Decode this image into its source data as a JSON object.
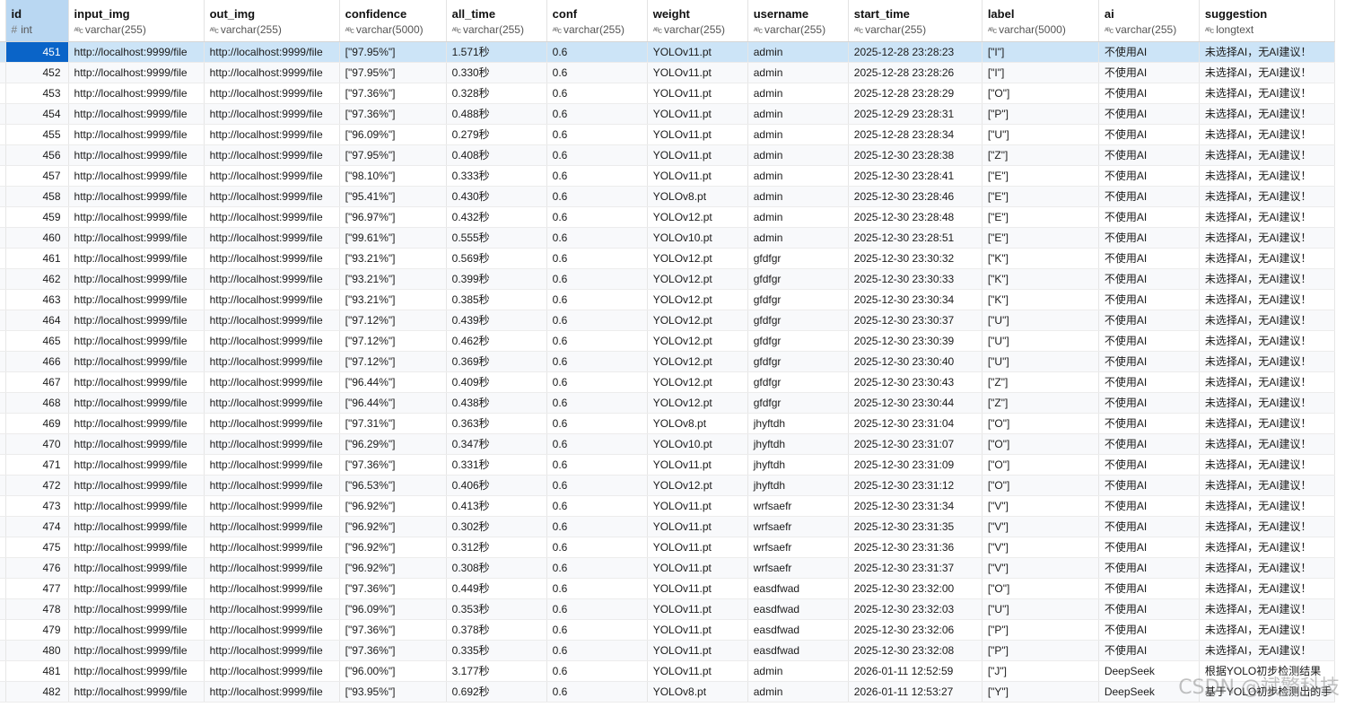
{
  "columns": [
    {
      "name": "id",
      "type": "int",
      "icon": "hash-icon"
    },
    {
      "name": "input_img",
      "type": "varchar(255)",
      "icon": "text-type-icon"
    },
    {
      "name": "out_img",
      "type": "varchar(255)",
      "icon": "text-type-icon"
    },
    {
      "name": "confidence",
      "type": "varchar(5000)",
      "icon": "text-type-icon"
    },
    {
      "name": "all_time",
      "type": "varchar(255)",
      "icon": "text-type-icon"
    },
    {
      "name": "conf",
      "type": "varchar(255)",
      "icon": "text-type-icon"
    },
    {
      "name": "weight",
      "type": "varchar(255)",
      "icon": "text-type-icon"
    },
    {
      "name": "username",
      "type": "varchar(255)",
      "icon": "text-type-icon"
    },
    {
      "name": "start_time",
      "type": "varchar(255)",
      "icon": "text-type-icon"
    },
    {
      "name": "label",
      "type": "varchar(5000)",
      "icon": "text-type-icon"
    },
    {
      "name": "ai",
      "type": "varchar(255)",
      "icon": "text-type-icon"
    },
    {
      "name": "suggestion",
      "type": "longtext",
      "icon": "text-type-icon"
    }
  ],
  "type_glyphs": {
    "hash": "#",
    "text": "ᴬᴮc"
  },
  "selected_row_index": 0,
  "rows": [
    [
      "451",
      "http://localhost:9999/file",
      "http://localhost:9999/file",
      "[\"97.95%\"]",
      "1.571秒",
      "0.6",
      "YOLOv11.pt",
      "admin",
      "2025-12-28 23:28:23",
      "[\"I\"]",
      "不使用AI",
      "未选择AI，无AI建议！"
    ],
    [
      "452",
      "http://localhost:9999/file",
      "http://localhost:9999/file",
      "[\"97.95%\"]",
      "0.330秒",
      "0.6",
      "YOLOv11.pt",
      "admin",
      "2025-12-28 23:28:26",
      "[\"I\"]",
      "不使用AI",
      "未选择AI，无AI建议！"
    ],
    [
      "453",
      "http://localhost:9999/file",
      "http://localhost:9999/file",
      "[\"97.36%\"]",
      "0.328秒",
      "0.6",
      "YOLOv11.pt",
      "admin",
      "2025-12-28 23:28:29",
      "[\"O\"]",
      "不使用AI",
      "未选择AI，无AI建议！"
    ],
    [
      "454",
      "http://localhost:9999/file",
      "http://localhost:9999/file",
      "[\"97.36%\"]",
      "0.488秒",
      "0.6",
      "YOLOv11.pt",
      "admin",
      "2025-12-29 23:28:31",
      "[\"P\"]",
      "不使用AI",
      "未选择AI，无AI建议！"
    ],
    [
      "455",
      "http://localhost:9999/file",
      "http://localhost:9999/file",
      "[\"96.09%\"]",
      "0.279秒",
      "0.6",
      "YOLOv11.pt",
      "admin",
      "2025-12-28 23:28:34",
      "[\"U\"]",
      "不使用AI",
      "未选择AI，无AI建议！"
    ],
    [
      "456",
      "http://localhost:9999/file",
      "http://localhost:9999/file",
      "[\"97.95%\"]",
      "0.408秒",
      "0.6",
      "YOLOv11.pt",
      "admin",
      "2025-12-30 23:28:38",
      "[\"Z\"]",
      "不使用AI",
      "未选择AI，无AI建议！"
    ],
    [
      "457",
      "http://localhost:9999/file",
      "http://localhost:9999/file",
      "[\"98.10%\"]",
      "0.333秒",
      "0.6",
      "YOLOv11.pt",
      "admin",
      "2025-12-30 23:28:41",
      "[\"E\"]",
      "不使用AI",
      "未选择AI，无AI建议！"
    ],
    [
      "458",
      "http://localhost:9999/file",
      "http://localhost:9999/file",
      "[\"95.41%\"]",
      "0.430秒",
      "0.6",
      "YOLOv8.pt",
      "admin",
      "2025-12-30 23:28:46",
      "[\"E\"]",
      "不使用AI",
      "未选择AI，无AI建议！"
    ],
    [
      "459",
      "http://localhost:9999/file",
      "http://localhost:9999/file",
      "[\"96.97%\"]",
      "0.432秒",
      "0.6",
      "YOLOv12.pt",
      "admin",
      "2025-12-30 23:28:48",
      "[\"E\"]",
      "不使用AI",
      "未选择AI，无AI建议！"
    ],
    [
      "460",
      "http://localhost:9999/file",
      "http://localhost:9999/file",
      "[\"99.61%\"]",
      "0.555秒",
      "0.6",
      "YOLOv10.pt",
      "admin",
      "2025-12-30 23:28:51",
      "[\"E\"]",
      "不使用AI",
      "未选择AI，无AI建议！"
    ],
    [
      "461",
      "http://localhost:9999/file",
      "http://localhost:9999/file",
      "[\"93.21%\"]",
      "0.569秒",
      "0.6",
      "YOLOv12.pt",
      "gfdfgr",
      "2025-12-30 23:30:32",
      "[\"K\"]",
      "不使用AI",
      "未选择AI，无AI建议！"
    ],
    [
      "462",
      "http://localhost:9999/file",
      "http://localhost:9999/file",
      "[\"93.21%\"]",
      "0.399秒",
      "0.6",
      "YOLOv12.pt",
      "gfdfgr",
      "2025-12-30 23:30:33",
      "[\"K\"]",
      "不使用AI",
      "未选择AI，无AI建议！"
    ],
    [
      "463",
      "http://localhost:9999/file",
      "http://localhost:9999/file",
      "[\"93.21%\"]",
      "0.385秒",
      "0.6",
      "YOLOv12.pt",
      "gfdfgr",
      "2025-12-30 23:30:34",
      "[\"K\"]",
      "不使用AI",
      "未选择AI，无AI建议！"
    ],
    [
      "464",
      "http://localhost:9999/file",
      "http://localhost:9999/file",
      "[\"97.12%\"]",
      "0.439秒",
      "0.6",
      "YOLOv12.pt",
      "gfdfgr",
      "2025-12-30 23:30:37",
      "[\"U\"]",
      "不使用AI",
      "未选择AI，无AI建议！"
    ],
    [
      "465",
      "http://localhost:9999/file",
      "http://localhost:9999/file",
      "[\"97.12%\"]",
      "0.462秒",
      "0.6",
      "YOLOv12.pt",
      "gfdfgr",
      "2025-12-30 23:30:39",
      "[\"U\"]",
      "不使用AI",
      "未选择AI，无AI建议！"
    ],
    [
      "466",
      "http://localhost:9999/file",
      "http://localhost:9999/file",
      "[\"97.12%\"]",
      "0.369秒",
      "0.6",
      "YOLOv12.pt",
      "gfdfgr",
      "2025-12-30 23:30:40",
      "[\"U\"]",
      "不使用AI",
      "未选择AI，无AI建议！"
    ],
    [
      "467",
      "http://localhost:9999/file",
      "http://localhost:9999/file",
      "[\"96.44%\"]",
      "0.409秒",
      "0.6",
      "YOLOv12.pt",
      "gfdfgr",
      "2025-12-30 23:30:43",
      "[\"Z\"]",
      "不使用AI",
      "未选择AI，无AI建议！"
    ],
    [
      "468",
      "http://localhost:9999/file",
      "http://localhost:9999/file",
      "[\"96.44%\"]",
      "0.438秒",
      "0.6",
      "YOLOv12.pt",
      "gfdfgr",
      "2025-12-30 23:30:44",
      "[\"Z\"]",
      "不使用AI",
      "未选择AI，无AI建议！"
    ],
    [
      "469",
      "http://localhost:9999/file",
      "http://localhost:9999/file",
      "[\"97.31%\"]",
      "0.363秒",
      "0.6",
      "YOLOv8.pt",
      "jhyftdh",
      "2025-12-30 23:31:04",
      "[\"O\"]",
      "不使用AI",
      "未选择AI，无AI建议！"
    ],
    [
      "470",
      "http://localhost:9999/file",
      "http://localhost:9999/file",
      "[\"96.29%\"]",
      "0.347秒",
      "0.6",
      "YOLOv10.pt",
      "jhyftdh",
      "2025-12-30 23:31:07",
      "[\"O\"]",
      "不使用AI",
      "未选择AI，无AI建议！"
    ],
    [
      "471",
      "http://localhost:9999/file",
      "http://localhost:9999/file",
      "[\"97.36%\"]",
      "0.331秒",
      "0.6",
      "YOLOv11.pt",
      "jhyftdh",
      "2025-12-30 23:31:09",
      "[\"O\"]",
      "不使用AI",
      "未选择AI，无AI建议！"
    ],
    [
      "472",
      "http://localhost:9999/file",
      "http://localhost:9999/file",
      "[\"96.53%\"]",
      "0.406秒",
      "0.6",
      "YOLOv12.pt",
      "jhyftdh",
      "2025-12-30 23:31:12",
      "[\"O\"]",
      "不使用AI",
      "未选择AI，无AI建议！"
    ],
    [
      "473",
      "http://localhost:9999/file",
      "http://localhost:9999/file",
      "[\"96.92%\"]",
      "0.413秒",
      "0.6",
      "YOLOv11.pt",
      "wrfsaefr",
      "2025-12-30 23:31:34",
      "[\"V\"]",
      "不使用AI",
      "未选择AI，无AI建议！"
    ],
    [
      "474",
      "http://localhost:9999/file",
      "http://localhost:9999/file",
      "[\"96.92%\"]",
      "0.302秒",
      "0.6",
      "YOLOv11.pt",
      "wrfsaefr",
      "2025-12-30 23:31:35",
      "[\"V\"]",
      "不使用AI",
      "未选择AI，无AI建议！"
    ],
    [
      "475",
      "http://localhost:9999/file",
      "http://localhost:9999/file",
      "[\"96.92%\"]",
      "0.312秒",
      "0.6",
      "YOLOv11.pt",
      "wrfsaefr",
      "2025-12-30 23:31:36",
      "[\"V\"]",
      "不使用AI",
      "未选择AI，无AI建议！"
    ],
    [
      "476",
      "http://localhost:9999/file",
      "http://localhost:9999/file",
      "[\"96.92%\"]",
      "0.308秒",
      "0.6",
      "YOLOv11.pt",
      "wrfsaefr",
      "2025-12-30 23:31:37",
      "[\"V\"]",
      "不使用AI",
      "未选择AI，无AI建议！"
    ],
    [
      "477",
      "http://localhost:9999/file",
      "http://localhost:9999/file",
      "[\"97.36%\"]",
      "0.449秒",
      "0.6",
      "YOLOv11.pt",
      "easdfwad",
      "2025-12-30 23:32:00",
      "[\"O\"]",
      "不使用AI",
      "未选择AI，无AI建议！"
    ],
    [
      "478",
      "http://localhost:9999/file",
      "http://localhost:9999/file",
      "[\"96.09%\"]",
      "0.353秒",
      "0.6",
      "YOLOv11.pt",
      "easdfwad",
      "2025-12-30 23:32:03",
      "[\"U\"]",
      "不使用AI",
      "未选择AI，无AI建议！"
    ],
    [
      "479",
      "http://localhost:9999/file",
      "http://localhost:9999/file",
      "[\"97.36%\"]",
      "0.378秒",
      "0.6",
      "YOLOv11.pt",
      "easdfwad",
      "2025-12-30 23:32:06",
      "[\"P\"]",
      "不使用AI",
      "未选择AI，无AI建议！"
    ],
    [
      "480",
      "http://localhost:9999/file",
      "http://localhost:9999/file",
      "[\"97.36%\"]",
      "0.335秒",
      "0.6",
      "YOLOv11.pt",
      "easdfwad",
      "2025-12-30 23:32:08",
      "[\"P\"]",
      "不使用AI",
      "未选择AI，无AI建议！"
    ],
    [
      "481",
      "http://localhost:9999/file",
      "http://localhost:9999/file",
      "[\"96.00%\"]",
      "3.177秒",
      "0.6",
      "YOLOv11.pt",
      "admin",
      "2026-01-11 12:52:59",
      "[\"J\"]",
      "DeepSeek",
      "根据YOLO初步检测结果"
    ],
    [
      "482",
      "http://localhost:9999/file",
      "http://localhost:9999/file",
      "[\"93.95%\"]",
      "0.692秒",
      "0.6",
      "YOLOv8.pt",
      "admin",
      "2026-01-11 12:53:27",
      "[\"Y\"]",
      "DeepSeek",
      "基于YOLO初步检测出的手"
    ]
  ],
  "watermark": "CSDN @斌擎科技"
}
